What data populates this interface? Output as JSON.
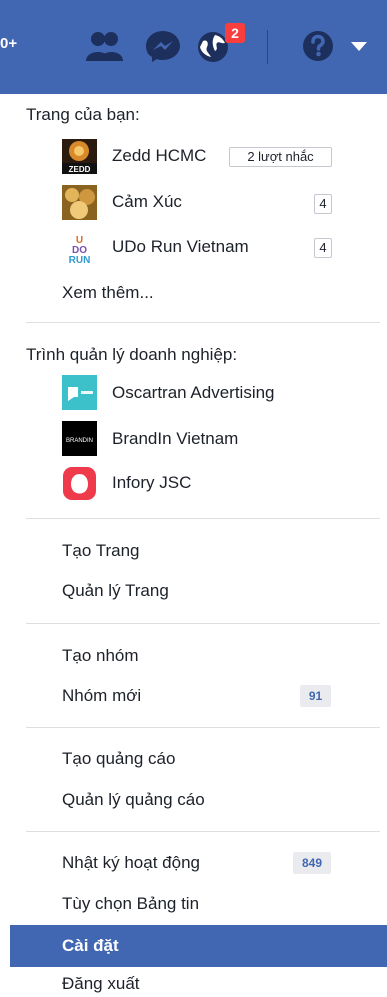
{
  "topbar": {
    "partial_badge": "0+",
    "notification_count": "2"
  },
  "pages_section": {
    "heading": "Trang của bạn:",
    "pages": [
      {
        "name": "Zedd HCMC",
        "badge": "2 lượt nhắc"
      },
      {
        "name": "Cảm Xúc",
        "badge": "4"
      },
      {
        "name": "UDo Run Vietnam",
        "badge": "4"
      }
    ],
    "see_more": "Xem thêm..."
  },
  "business_section": {
    "heading": "Trình quản lý doanh nghiệp:",
    "accounts": [
      {
        "name": "Oscartran Advertising"
      },
      {
        "name": "BrandIn Vietnam"
      },
      {
        "name": "Infory JSC"
      }
    ]
  },
  "page_actions": {
    "create": "Tạo Trang",
    "manage": "Quản lý Trang"
  },
  "group_actions": {
    "create": "Tạo nhóm",
    "new_groups": "Nhóm mới",
    "new_groups_count": "91"
  },
  "ad_actions": {
    "create": "Tạo quảng cáo",
    "manage": "Quản lý quảng cáo"
  },
  "account_actions": {
    "activity_log": "Nhật ký hoạt động",
    "activity_log_count": "849",
    "news_feed_prefs": "Tùy chọn Bảng tin",
    "settings": "Cài đặt",
    "logout": "Đăng xuất"
  },
  "thumb_text": {
    "zedd": "ZEDD",
    "udo": "U DO RUN",
    "brandin": "BRANDIN"
  },
  "colors": {
    "topbar": "#4267b2",
    "selected": "#4267b2",
    "notification": "#fa3e3e"
  }
}
